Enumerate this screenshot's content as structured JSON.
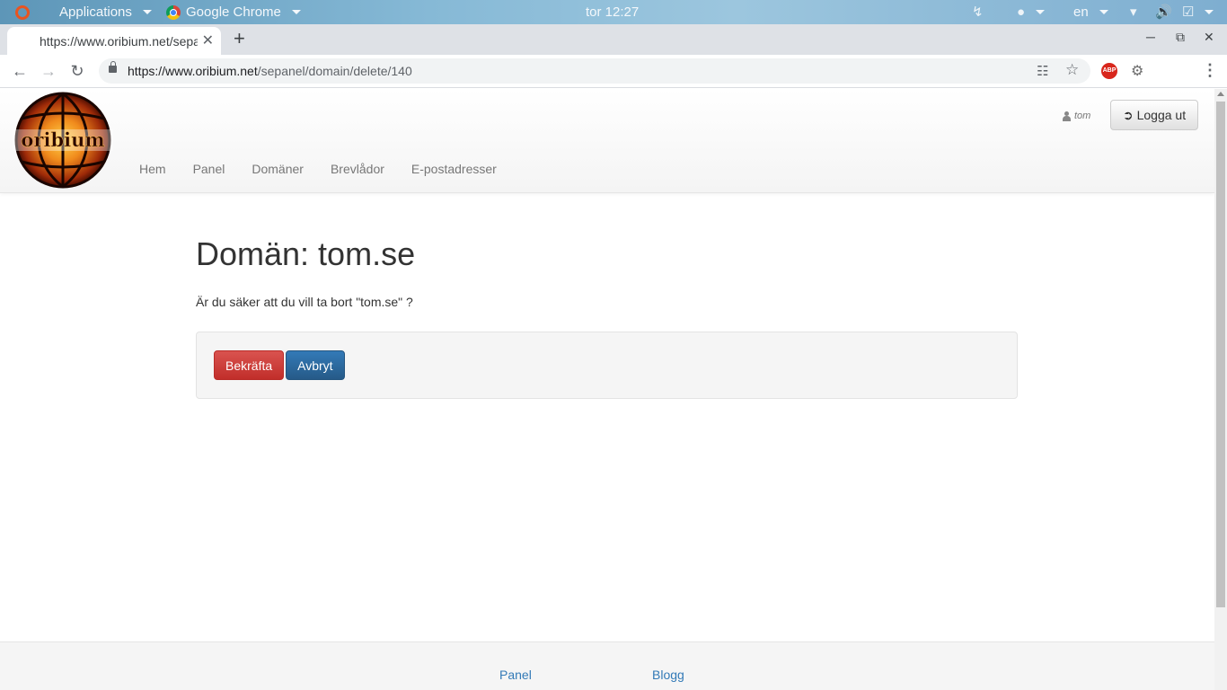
{
  "system_bar": {
    "applications": "Applications",
    "active_app": "Google Chrome",
    "clock": "tor 12:27",
    "language": "en"
  },
  "browser": {
    "tab_title": "https://www.oribium.net/sepanel/domain/delete/140",
    "url_host": "https://www.oribium.net",
    "url_path": "/sepanel/domain/delete/140"
  },
  "site": {
    "logo_text": "oribium",
    "nav": [
      "Hem",
      "Panel",
      "Domäner",
      "Brevlådor",
      "E-postadresser"
    ],
    "username": "tom",
    "logout_label": "Logga ut"
  },
  "main": {
    "title": "Domän: tom.se",
    "question": "Är du säker att du vill ta bort \"tom.se\" ?",
    "confirm_label": "Bekräfta",
    "cancel_label": "Avbryt"
  },
  "footer": {
    "links": [
      "Panel",
      "Blogg"
    ]
  },
  "colors": {
    "danger": "#d9534f",
    "primary": "#337ab7",
    "link": "#337ab7"
  }
}
